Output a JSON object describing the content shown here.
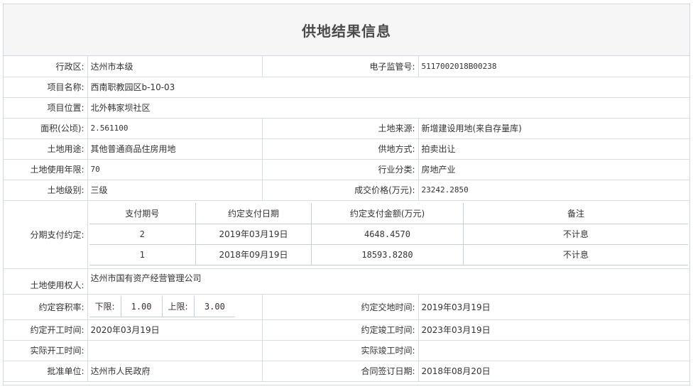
{
  "title": "供地结果信息",
  "rows": {
    "district": {
      "label": "行政区:",
      "value": "达州市本级"
    },
    "supervision_no": {
      "label": "电子监管号:",
      "value": "5117002018B00238"
    },
    "project_name": {
      "label": "项目名称:",
      "value": "西南职教园区b-10-03"
    },
    "project_location": {
      "label": "项目位置:",
      "value": "北外韩家坝社区"
    },
    "area": {
      "label": "面积(公顷):",
      "value": "2.561100"
    },
    "land_source": {
      "label": "土地来源:",
      "value": "新增建设用地(来自存量库)"
    },
    "land_use": {
      "label": "土地用途:",
      "value": "其他普通商品住房用地"
    },
    "supply_method": {
      "label": "供地方式:",
      "value": "拍卖出让"
    },
    "use_years": {
      "label": "土地使用年限:",
      "value": "70"
    },
    "industry": {
      "label": "行业分类:",
      "value": "房地产业"
    },
    "land_grade": {
      "label": "土地级别:",
      "value": "三级"
    },
    "price": {
      "label": "成交价格(万元):",
      "value": "23242.2850"
    },
    "installments": {
      "label": "分期支付约定:",
      "headers": [
        "支付期号",
        "约定支付日期",
        "约定支付金额(万元)",
        "备注"
      ],
      "items": [
        {
          "no": "2",
          "date": "2019年03月19日",
          "amount": "4648.4570",
          "note": "不计息"
        },
        {
          "no": "1",
          "date": "2018年09月19日",
          "amount": "18593.8280",
          "note": "不计息"
        }
      ]
    },
    "land_user": {
      "label": "土地使用权人:",
      "value": "达州市国有资产经营管理公司"
    },
    "far": {
      "label": "约定容积率:",
      "lower_label": "下限:",
      "lower": "1.00",
      "upper_label": "上限:",
      "upper": "3.00"
    },
    "handover_time": {
      "label": "约定交地时间:",
      "value": "2019年03月19日"
    },
    "start_time": {
      "label": "约定开工时间:",
      "value": "2020年03月19日"
    },
    "completion_time": {
      "label": "约定竣工时间:",
      "value": "2023年03月19日"
    },
    "actual_start": {
      "label": "实际开工时间:",
      "value": ""
    },
    "actual_completion": {
      "label": "实际竣工时间:",
      "value": ""
    },
    "approval_unit": {
      "label": "批准单位:",
      "value": "达州市人民政府"
    },
    "contract_date": {
      "label": "合同签订日期:",
      "value": "2018年08月20日"
    }
  }
}
